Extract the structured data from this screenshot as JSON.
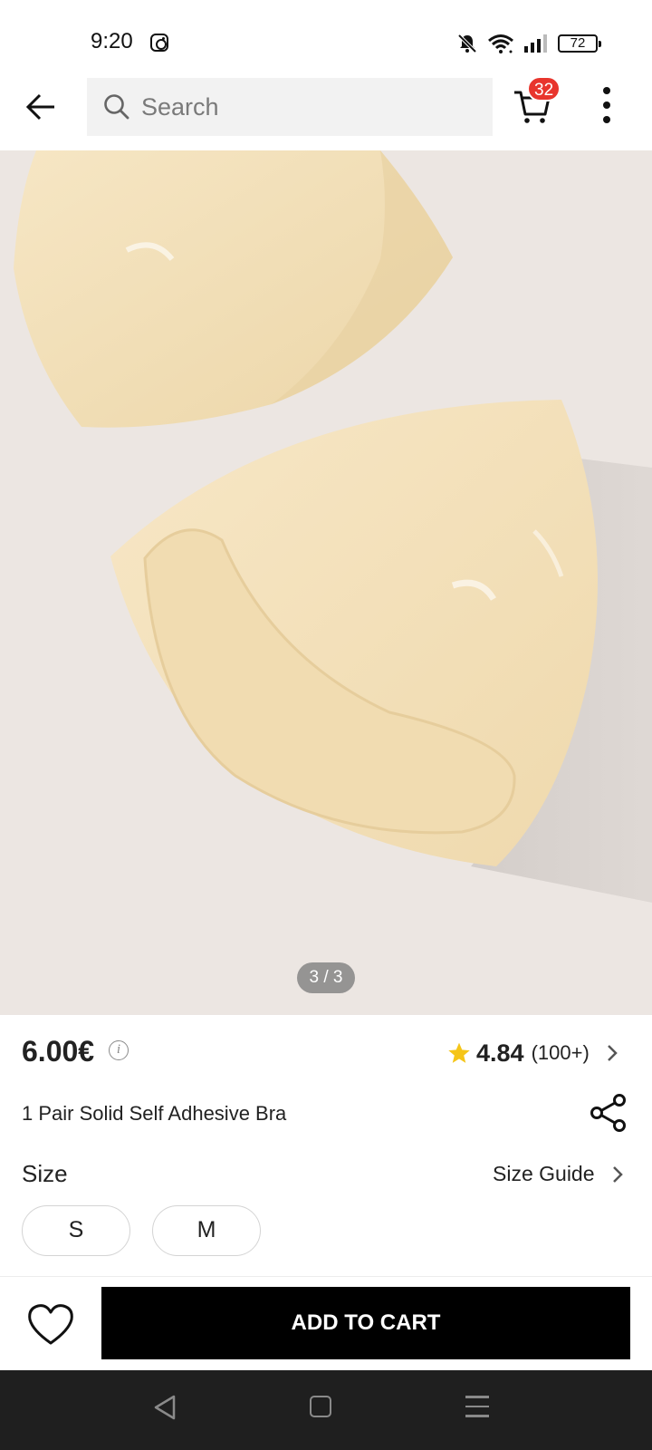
{
  "status_bar": {
    "time": "9:20",
    "battery": "72",
    "icons": [
      "instagram-icon",
      "mute-icon",
      "wifi-icon",
      "signal-icon",
      "battery-icon"
    ]
  },
  "top_nav": {
    "search_placeholder": "Search",
    "cart_count": "32"
  },
  "gallery": {
    "counter": "3 / 3",
    "current_image": 3,
    "total_images": 3
  },
  "product": {
    "price": "6.00€",
    "rating": "4.84",
    "review_count": "(100+)",
    "title": "1 Pair Solid Self Adhesive Bra"
  },
  "size": {
    "label": "Size",
    "guide_label": "Size Guide",
    "options": [
      "S",
      "M"
    ]
  },
  "actions": {
    "add_to_cart": "ADD TO CART"
  },
  "colors": {
    "accent": "#000000",
    "badge": "#e8352d",
    "star": "#f5c518",
    "image_background": "#ece6e2",
    "product": "#f2dfb8"
  }
}
